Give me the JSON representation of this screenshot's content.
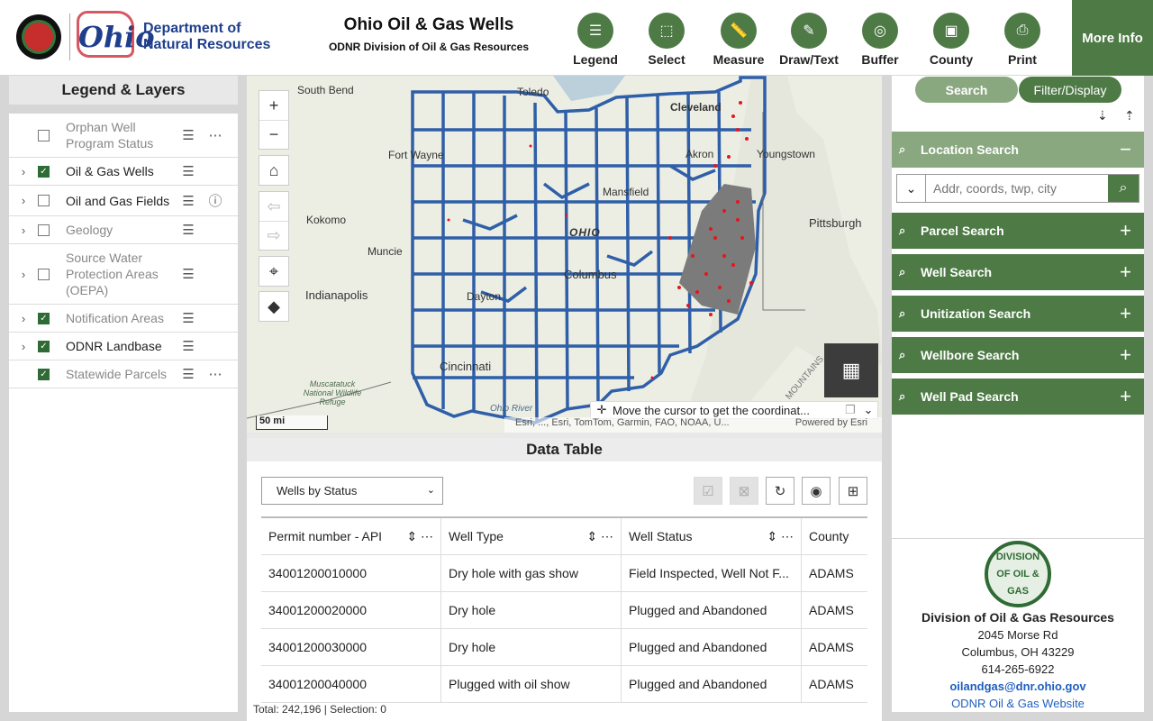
{
  "header": {
    "agency_line1": "Department of",
    "agency_line2": "Natural Resources",
    "ohio_wordmark": "Ohio",
    "title": "Ohio Oil & Gas Wells",
    "subtitle": "ODNR Division of Oil & Gas Resources",
    "tools": [
      {
        "label": "Legend",
        "icon": "legend-icon"
      },
      {
        "label": "Select",
        "icon": "select-icon"
      },
      {
        "label": "Measure",
        "icon": "ruler-icon"
      },
      {
        "label": "Draw/Text",
        "icon": "draw-icon"
      },
      {
        "label": "Buffer",
        "icon": "buffer-icon"
      },
      {
        "label": "County",
        "icon": "county-icon"
      },
      {
        "label": "Print",
        "icon": "printer-icon"
      }
    ],
    "more_info": "More Info"
  },
  "legend": {
    "title": "Legend & Layers",
    "layers": [
      {
        "name": "Orphan Well Program Status",
        "checked": false,
        "expandable": false,
        "dim": true,
        "extra": "more"
      },
      {
        "name": "Oil & Gas Wells",
        "checked": true,
        "expandable": true,
        "dim": false,
        "extra": "list"
      },
      {
        "name": "Oil and Gas Fields",
        "checked": false,
        "expandable": true,
        "dim": false,
        "extra": "info"
      },
      {
        "name": "Geology",
        "checked": false,
        "expandable": true,
        "dim": true,
        "extra": "list"
      },
      {
        "name": "Source Water Protection Areas (OEPA)",
        "checked": false,
        "expandable": true,
        "dim": true,
        "extra": "list"
      },
      {
        "name": "Notification Areas",
        "checked": true,
        "expandable": true,
        "dim": true,
        "extra": "list"
      },
      {
        "name": "ODNR Landbase",
        "checked": true,
        "expandable": true,
        "dim": false,
        "extra": "list"
      },
      {
        "name": "Statewide Parcels",
        "checked": true,
        "expandable": false,
        "dim": true,
        "extra": "more"
      }
    ]
  },
  "map": {
    "labels": [
      "South Bend",
      "Toledo",
      "Cleveland",
      "Fort Wayne",
      "Akron",
      "Youngstown",
      "Mansfield",
      "Kokomo",
      "OHIO",
      "Pittsburgh",
      "Muncie",
      "Columbus",
      "Indianapolis",
      "Dayton",
      "Cincinnati",
      "Muscatatuck National Wildlife Refuge",
      "Ohio River",
      "MOUNTAINS"
    ],
    "scale": "50 mi",
    "coord_hint": "Move the cursor to get the coordinat...",
    "attribution": "Esri, ..., Esri, TomTom, Garmin, FAO, NOAA, U...",
    "powered_by": "Powered by Esri"
  },
  "datatable": {
    "title": "Data Table",
    "dropdown": "Wells by Status",
    "columns": [
      "Permit number - API",
      "Well Type",
      "Well Status",
      "County"
    ],
    "rows": [
      [
        "34001200010000",
        "Dry hole with gas show",
        "Field Inspected, Well Not F...",
        "ADAMS"
      ],
      [
        "34001200020000",
        "Dry hole",
        "Plugged and Abandoned",
        "ADAMS"
      ],
      [
        "34001200030000",
        "Dry hole",
        "Plugged and Abandoned",
        "ADAMS"
      ],
      [
        "34001200040000",
        "Plugged with oil show",
        "Plugged and Abandoned",
        "ADAMS"
      ]
    ],
    "footer": "Total: 242,196 | Selection: 0"
  },
  "search": {
    "tabs": [
      "Search",
      "Filter/Display"
    ],
    "location": {
      "title": "Location Search",
      "placeholder": "Addr, coords, twp, city"
    },
    "sections": [
      "Parcel Search",
      "Well Search",
      "Unitization Search",
      "Wellbore Search",
      "Well Pad Search"
    ]
  },
  "contact": {
    "badge": "DIVISION OF OIL & GAS",
    "name": "Division of Oil & Gas Resources",
    "address1": "2045 Morse Rd",
    "address2": "Columbus, OH 43229",
    "phone": "614-265-6922",
    "email": "oilandgas@dnr.ohio.gov",
    "website": "ODNR Oil & Gas Website"
  },
  "colors": {
    "accent": "#4d7a45",
    "accent_light": "#8aa880",
    "county_lines": "#2f5fa8",
    "wells": "#e8141b"
  }
}
